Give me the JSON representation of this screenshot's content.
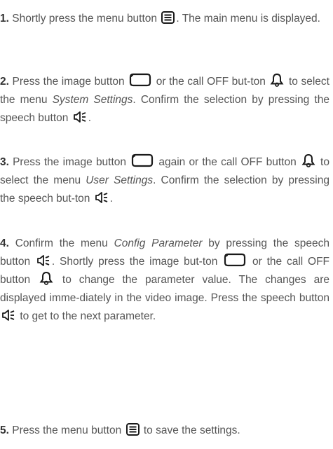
{
  "steps": [
    {
      "number": "1.",
      "parts": {
        "a": "Shortly press the menu button",
        "b": ". The main menu is displayed."
      }
    },
    {
      "number": "2.",
      "parts": {
        "a": "Press the image button",
        "b": "or the call OFF but-ton",
        "c": "to select the menu",
        "d": "System Settings",
        "e": ". Confirm the selection by pressing the speech button",
        "f": "."
      }
    },
    {
      "number": "3.",
      "parts": {
        "a": "Press the image button",
        "b": "again or the call OFF button",
        "c": "to select the menu",
        "d": "User Settings",
        "e": ". Confirm the selection by pressing the speech but-ton",
        "f": "."
      }
    },
    {
      "number": "4.",
      "parts": {
        "a": "Confirm the menu",
        "b": "Config Parameter",
        "c": "by pressing the speech button",
        "d": ". Shortly press the image but-ton",
        "e": "or the call OFF button",
        "f": "to change the parameter value. The changes are displayed imme-diately in the video image. Press the speech button",
        "g": "to get to the next parameter."
      }
    },
    {
      "number": "5.",
      "parts": {
        "a": "Press the menu button",
        "b": "to save the settings."
      }
    }
  ],
  "icons": {
    "menu": "menu-button-icon",
    "image": "image-button-icon",
    "call_off": "bell-icon",
    "speech": "speaker-icon"
  },
  "colors": {
    "text": "#555555",
    "step_number": "#333333"
  }
}
